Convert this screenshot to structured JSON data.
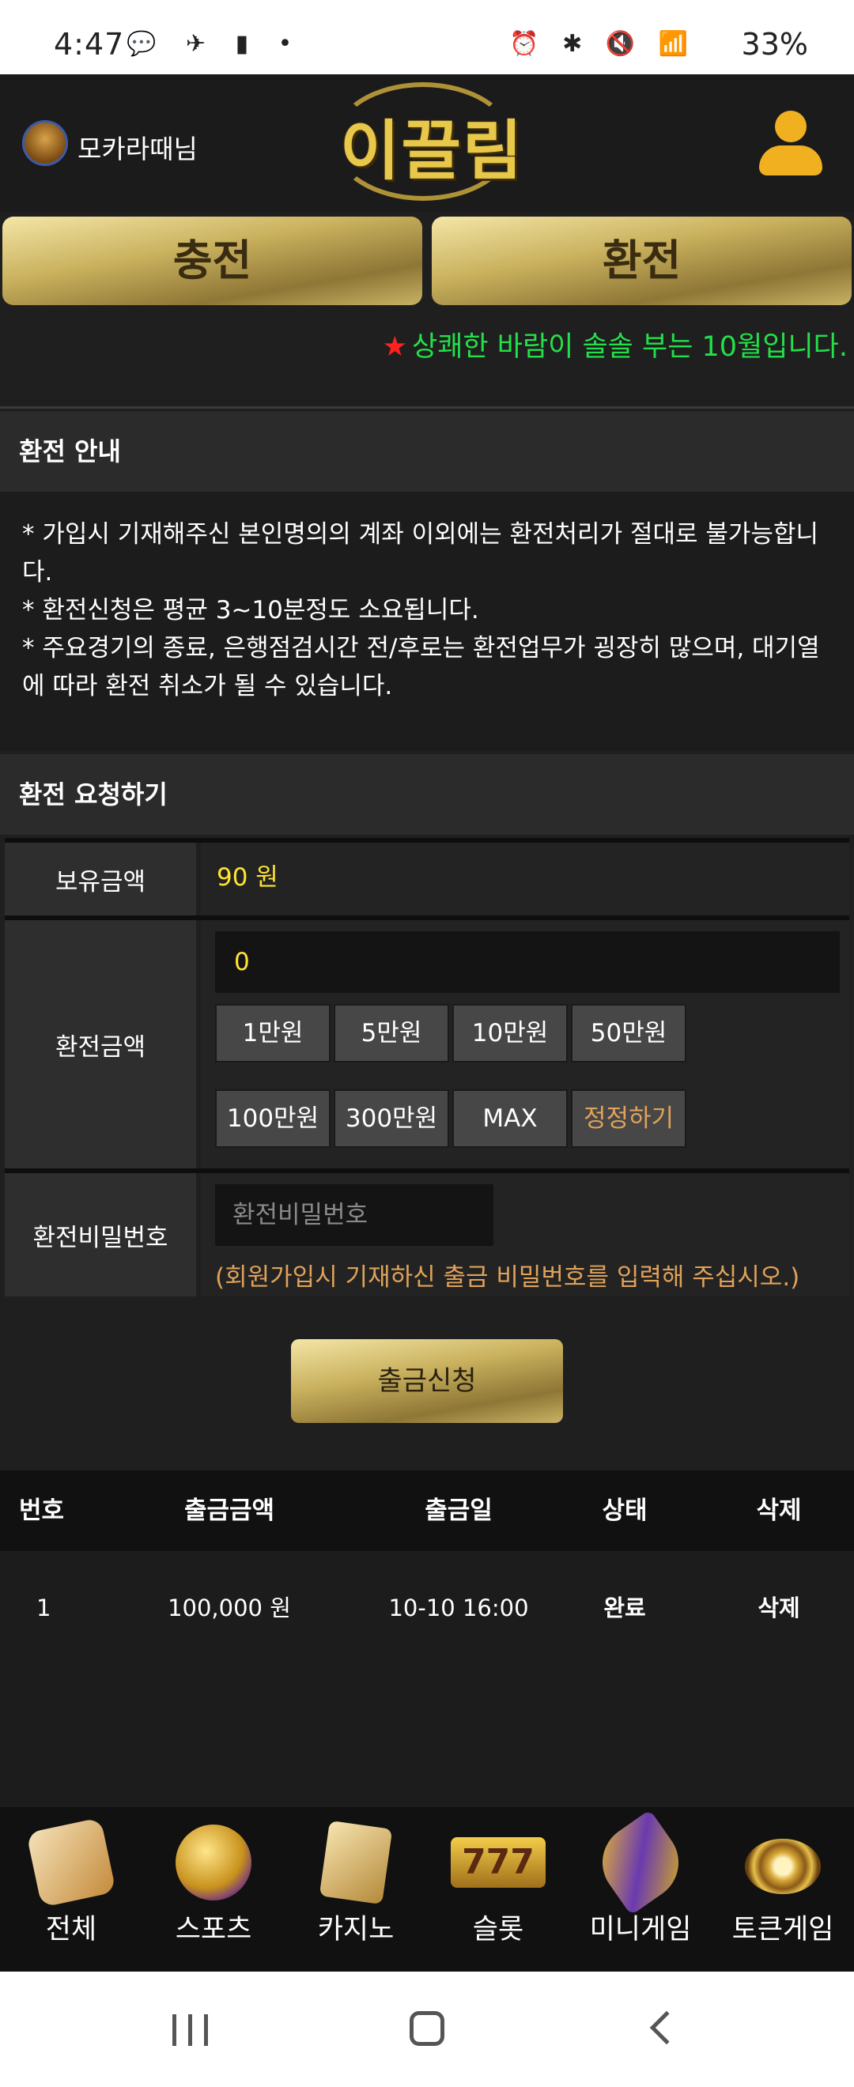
{
  "status_bar": {
    "time": "4:47",
    "left_icons": "💬 ✈ ▮ •",
    "right_icons": "⏰ ✱ 🔇 📶",
    "battery": "33%"
  },
  "header": {
    "username": "모카라때님",
    "logo_text": "이끌림"
  },
  "top_buttons": {
    "charge": "충전",
    "exchange": "환전"
  },
  "notice": {
    "star": "★",
    "text": "상쾌한 바람이 솔솔 부는 10월입니다."
  },
  "info": {
    "title": "환전 안내",
    "lines": [
      "* 가입시 기재해주신 본인명의의 계좌 이외에는 환전처리가 절대로 불가능합니다.",
      "* 환전신청은 평균 3~10분정도 소요됩니다.",
      "* 주요경기의 종료, 은행점검시간 전/후로는 환전업무가 굉장히 많으며, 대기열에 따라 환전 취소가 될 수 있습니다."
    ]
  },
  "request": {
    "title": "환전 요청하기",
    "holding_label": "보유금액",
    "holding_value": "90 원",
    "amount_label": "환전금액",
    "amount_value": "0",
    "chips": [
      "1만원",
      "5만원",
      "10만원",
      "50만원",
      "100만원",
      "300만원",
      "MAX",
      "정정하기"
    ],
    "password_label": "환전비밀번호",
    "password_placeholder": "환전비밀번호",
    "password_hint": "(회원가입시 기재하신 출금 비밀번호를 입력해 주십시오.)",
    "submit": "출금신청"
  },
  "table": {
    "headers": [
      "번호",
      "출금금액",
      "출금일",
      "상태",
      "삭제"
    ],
    "rows": [
      [
        "1",
        "100,000 원",
        "10-10 16:00",
        "완료",
        "삭제"
      ]
    ]
  },
  "bottom_nav": [
    {
      "label": "전체",
      "icon": "dice-icon"
    },
    {
      "label": "스포츠",
      "icon": "soccer-ball-icon"
    },
    {
      "label": "카지노",
      "icon": "playing-cards-icon"
    },
    {
      "label": "슬롯",
      "icon": "slot-777-icon",
      "glyph": "777"
    },
    {
      "label": "미니게임",
      "icon": "rocket-icon"
    },
    {
      "label": "토큰게임",
      "icon": "roulette-icon"
    }
  ],
  "colors": {
    "gold_button": "#c9b15e",
    "notice_green": "#23e04a",
    "highlight_yellow": "#ffe432",
    "hint_orange": "#e0a25a"
  }
}
